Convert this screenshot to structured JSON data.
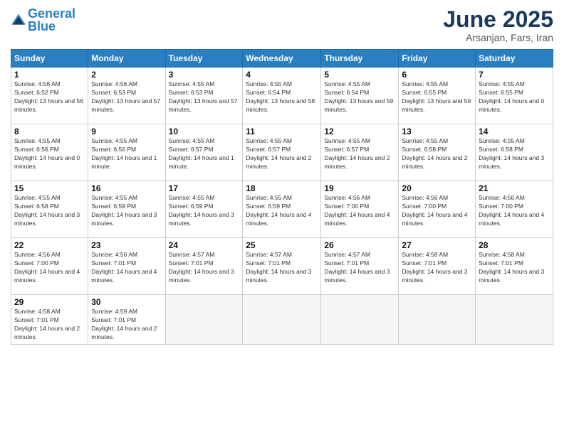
{
  "header": {
    "logo_general": "General",
    "logo_blue": "Blue",
    "month_title": "June 2025",
    "subtitle": "Arsanjan, Fars, Iran"
  },
  "weekdays": [
    "Sunday",
    "Monday",
    "Tuesday",
    "Wednesday",
    "Thursday",
    "Friday",
    "Saturday"
  ],
  "weeks": [
    [
      {
        "day": "1",
        "sunrise": "Sunrise: 4:56 AM",
        "sunset": "Sunset: 6:52 PM",
        "daylight": "Daylight: 13 hours and 56 minutes."
      },
      {
        "day": "2",
        "sunrise": "Sunrise: 4:56 AM",
        "sunset": "Sunset: 6:53 PM",
        "daylight": "Daylight: 13 hours and 57 minutes."
      },
      {
        "day": "3",
        "sunrise": "Sunrise: 4:55 AM",
        "sunset": "Sunset: 6:53 PM",
        "daylight": "Daylight: 13 hours and 57 minutes."
      },
      {
        "day": "4",
        "sunrise": "Sunrise: 4:55 AM",
        "sunset": "Sunset: 6:54 PM",
        "daylight": "Daylight: 13 hours and 58 minutes."
      },
      {
        "day": "5",
        "sunrise": "Sunrise: 4:55 AM",
        "sunset": "Sunset: 6:54 PM",
        "daylight": "Daylight: 13 hours and 59 minutes."
      },
      {
        "day": "6",
        "sunrise": "Sunrise: 4:55 AM",
        "sunset": "Sunset: 6:55 PM",
        "daylight": "Daylight: 13 hours and 59 minutes."
      },
      {
        "day": "7",
        "sunrise": "Sunrise: 4:55 AM",
        "sunset": "Sunset: 6:55 PM",
        "daylight": "Daylight: 14 hours and 0 minutes."
      }
    ],
    [
      {
        "day": "8",
        "sunrise": "Sunrise: 4:55 AM",
        "sunset": "Sunset: 6:56 PM",
        "daylight": "Daylight: 14 hours and 0 minutes."
      },
      {
        "day": "9",
        "sunrise": "Sunrise: 4:55 AM",
        "sunset": "Sunset: 6:56 PM",
        "daylight": "Daylight: 14 hours and 1 minute."
      },
      {
        "day": "10",
        "sunrise": "Sunrise: 4:55 AM",
        "sunset": "Sunset: 6:57 PM",
        "daylight": "Daylight: 14 hours and 1 minute."
      },
      {
        "day": "11",
        "sunrise": "Sunrise: 4:55 AM",
        "sunset": "Sunset: 6:57 PM",
        "daylight": "Daylight: 14 hours and 2 minutes."
      },
      {
        "day": "12",
        "sunrise": "Sunrise: 4:55 AM",
        "sunset": "Sunset: 6:57 PM",
        "daylight": "Daylight: 14 hours and 2 minutes."
      },
      {
        "day": "13",
        "sunrise": "Sunrise: 4:55 AM",
        "sunset": "Sunset: 6:58 PM",
        "daylight": "Daylight: 14 hours and 2 minutes."
      },
      {
        "day": "14",
        "sunrise": "Sunrise: 4:55 AM",
        "sunset": "Sunset: 6:58 PM",
        "daylight": "Daylight: 14 hours and 3 minutes."
      }
    ],
    [
      {
        "day": "15",
        "sunrise": "Sunrise: 4:55 AM",
        "sunset": "Sunset: 6:58 PM",
        "daylight": "Daylight: 14 hours and 3 minutes."
      },
      {
        "day": "16",
        "sunrise": "Sunrise: 4:55 AM",
        "sunset": "Sunset: 6:59 PM",
        "daylight": "Daylight: 14 hours and 3 minutes."
      },
      {
        "day": "17",
        "sunrise": "Sunrise: 4:55 AM",
        "sunset": "Sunset: 6:59 PM",
        "daylight": "Daylight: 14 hours and 3 minutes."
      },
      {
        "day": "18",
        "sunrise": "Sunrise: 4:55 AM",
        "sunset": "Sunset: 6:59 PM",
        "daylight": "Daylight: 14 hours and 4 minutes."
      },
      {
        "day": "19",
        "sunrise": "Sunrise: 4:56 AM",
        "sunset": "Sunset: 7:00 PM",
        "daylight": "Daylight: 14 hours and 4 minutes."
      },
      {
        "day": "20",
        "sunrise": "Sunrise: 4:56 AM",
        "sunset": "Sunset: 7:00 PM",
        "daylight": "Daylight: 14 hours and 4 minutes."
      },
      {
        "day": "21",
        "sunrise": "Sunrise: 4:56 AM",
        "sunset": "Sunset: 7:00 PM",
        "daylight": "Daylight: 14 hours and 4 minutes."
      }
    ],
    [
      {
        "day": "22",
        "sunrise": "Sunrise: 4:56 AM",
        "sunset": "Sunset: 7:00 PM",
        "daylight": "Daylight: 14 hours and 4 minutes."
      },
      {
        "day": "23",
        "sunrise": "Sunrise: 4:56 AM",
        "sunset": "Sunset: 7:01 PM",
        "daylight": "Daylight: 14 hours and 4 minutes."
      },
      {
        "day": "24",
        "sunrise": "Sunrise: 4:57 AM",
        "sunset": "Sunset: 7:01 PM",
        "daylight": "Daylight: 14 hours and 3 minutes."
      },
      {
        "day": "25",
        "sunrise": "Sunrise: 4:57 AM",
        "sunset": "Sunset: 7:01 PM",
        "daylight": "Daylight: 14 hours and 3 minutes."
      },
      {
        "day": "26",
        "sunrise": "Sunrise: 4:57 AM",
        "sunset": "Sunset: 7:01 PM",
        "daylight": "Daylight: 14 hours and 3 minutes."
      },
      {
        "day": "27",
        "sunrise": "Sunrise: 4:58 AM",
        "sunset": "Sunset: 7:01 PM",
        "daylight": "Daylight: 14 hours and 3 minutes."
      },
      {
        "day": "28",
        "sunrise": "Sunrise: 4:58 AM",
        "sunset": "Sunset: 7:01 PM",
        "daylight": "Daylight: 14 hours and 3 minutes."
      }
    ],
    [
      {
        "day": "29",
        "sunrise": "Sunrise: 4:58 AM",
        "sunset": "Sunset: 7:01 PM",
        "daylight": "Daylight: 14 hours and 2 minutes."
      },
      {
        "day": "30",
        "sunrise": "Sunrise: 4:59 AM",
        "sunset": "Sunset: 7:01 PM",
        "daylight": "Daylight: 14 hours and 2 minutes."
      },
      null,
      null,
      null,
      null,
      null
    ]
  ]
}
